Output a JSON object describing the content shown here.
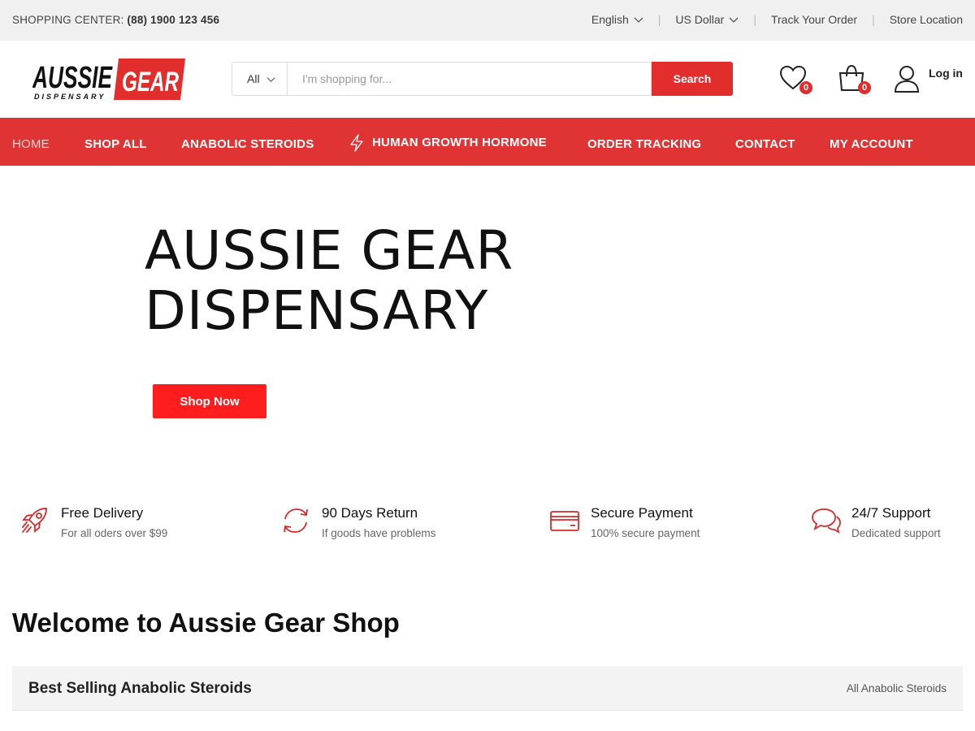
{
  "topbar": {
    "shopping_label": "SHOPPING CENTER:",
    "phone": "(88) 1900 123 456",
    "language": "English",
    "currency": "US Dollar",
    "track_order": "Track Your Order",
    "store_location": "Store Location"
  },
  "header": {
    "logo_word1": "AUSSIE",
    "logo_word2": "GEAR",
    "logo_sub": "DISPENSARY",
    "search_category": "All",
    "search_placeholder": "I'm shopping for...",
    "search_button": "Search",
    "wishlist_count": "0",
    "cart_count": "0",
    "login": "Log in"
  },
  "nav": {
    "items": [
      {
        "label": "HOME"
      },
      {
        "label": "SHOP ALL"
      },
      {
        "label": "ANABOLIC STEROIDS"
      },
      {
        "label": "HUMAN GROWTH HORMONE"
      },
      {
        "label": "ORDER TRACKING"
      },
      {
        "label": "CONTACT"
      },
      {
        "label": "MY ACCOUNT"
      }
    ]
  },
  "hero": {
    "line1": "AUSSIE GEAR",
    "line2": "DISPENSARY",
    "button": "Shop Now"
  },
  "features": [
    {
      "title": "Free Delivery",
      "subtitle": "For all oders over $99",
      "icon": "rocket-icon"
    },
    {
      "title": "90 Days Return",
      "subtitle": "If goods have problems",
      "icon": "refresh-icon"
    },
    {
      "title": "Secure Payment",
      "subtitle": "100% secure payment",
      "icon": "credit-card-icon"
    },
    {
      "title": "24/7 Support",
      "subtitle": "Dedicated support",
      "icon": "chat-icon"
    }
  ],
  "welcome": "Welcome to Aussie Gear Shop",
  "section": {
    "title": "Best Selling Anabolic Steroids",
    "link": "All Anabolic Steroids"
  },
  "colors": {
    "accent": "#e03434",
    "button_red": "#ff1e1e",
    "topbar_bg": "#f0f0f0"
  }
}
